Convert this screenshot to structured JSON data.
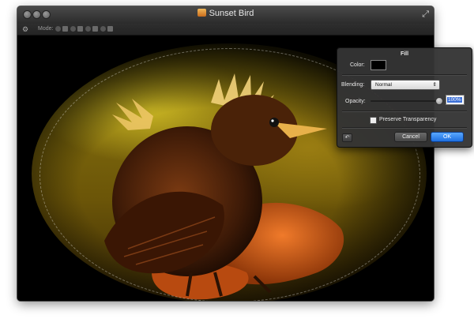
{
  "window": {
    "title": "Sunset Bird",
    "fullscreen_icon": "fullscreen-arrows-icon"
  },
  "toolbar": {
    "mode_label": "Mode:"
  },
  "dialog": {
    "title": "Fill",
    "color_label": "Color:",
    "color_value": "#000000",
    "blending_label": "Blending:",
    "blending_value": "Normal",
    "opacity_label": "Opacity:",
    "opacity_value": "100%",
    "opacity_fraction": 1.0,
    "preserve_label": "Preserve Transparency",
    "preserve_checked": false,
    "cancel_label": "Cancel",
    "ok_label": "OK"
  },
  "colors": {
    "accent": "#1e6fe0",
    "selection": "#3b6fd6"
  }
}
